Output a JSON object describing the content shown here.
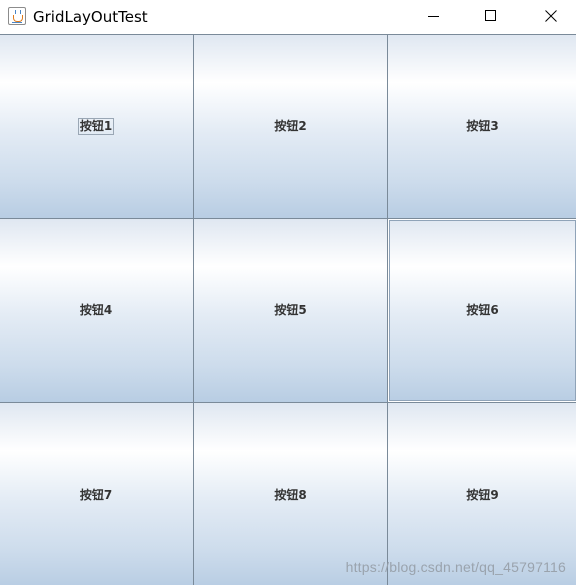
{
  "window": {
    "title": "GridLayOutTest",
    "icon": "java-cup-icon",
    "controls": {
      "minimize": "minimize-icon",
      "maximize": "maximize-icon",
      "close": "close-icon"
    }
  },
  "grid": {
    "rows": 3,
    "columns": 3,
    "buttons": [
      {
        "label": "按钮1",
        "focused": true
      },
      {
        "label": "按钮2"
      },
      {
        "label": "按钮3"
      },
      {
        "label": "按钮4"
      },
      {
        "label": "按钮5"
      },
      {
        "label": "按钮6",
        "rollover": true
      },
      {
        "label": "按钮7"
      },
      {
        "label": "按钮8"
      },
      {
        "label": "按钮9"
      }
    ]
  },
  "watermark": "https://blog.csdn.net/qq_45797116",
  "colors": {
    "button_border": "#7a8a99",
    "button_top": "#dfe7f1",
    "button_bottom": "#b8cde3",
    "label_text": "#333333",
    "watermark_text": "#9aa3ad"
  }
}
